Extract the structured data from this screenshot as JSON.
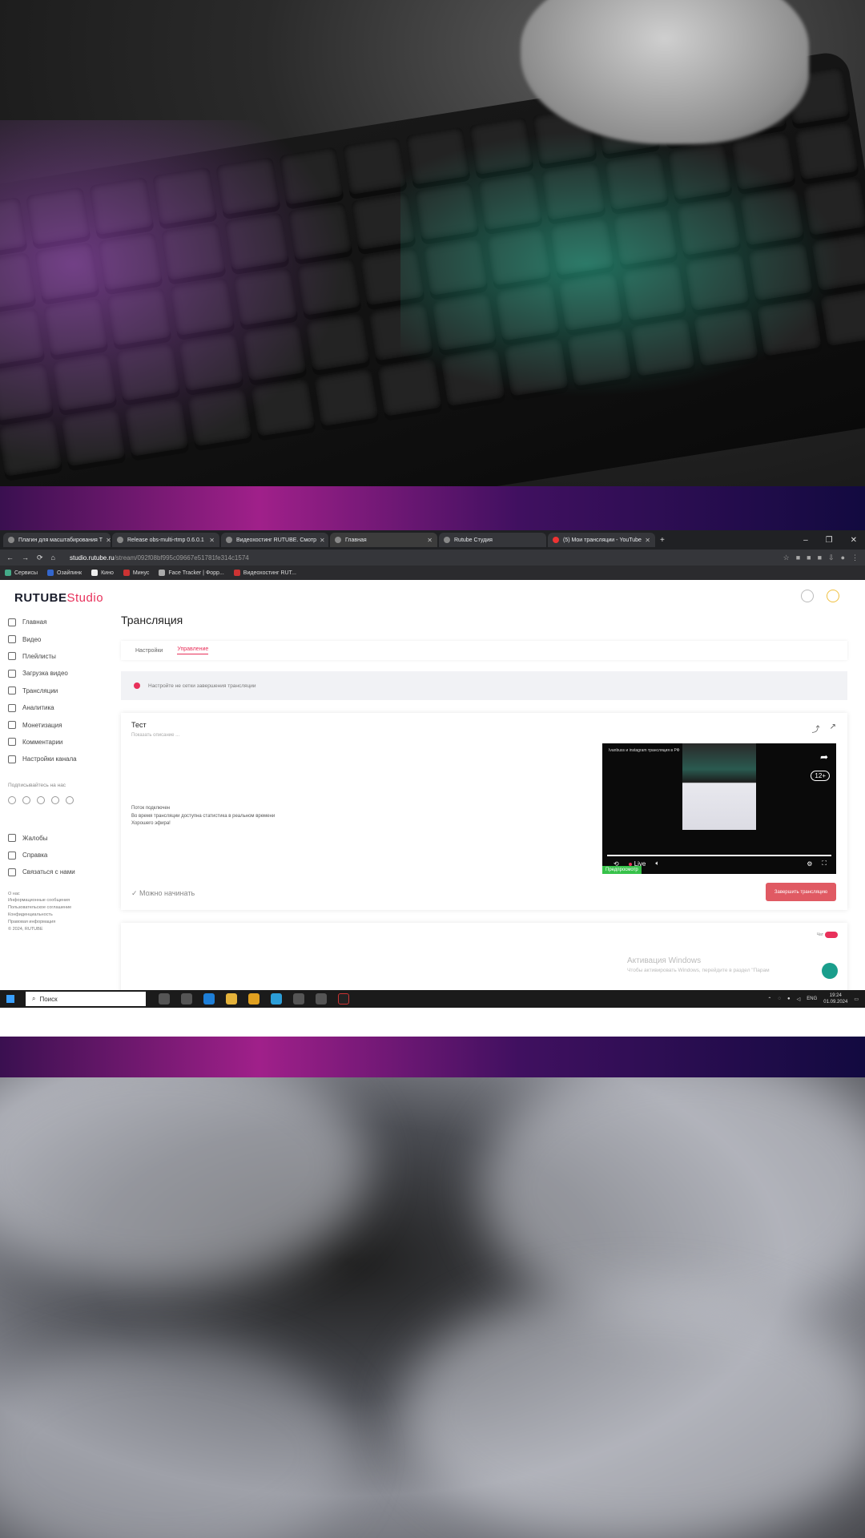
{
  "browser": {
    "tabs": [
      {
        "title": "Плагин для масштабирования Т"
      },
      {
        "title": "Release obs-multi-rtmp 0.6.0.1"
      },
      {
        "title": "Видеохостинг RUTUBE. Смотр"
      },
      {
        "title": "Главная"
      },
      {
        "title": "Rutube Студия"
      },
      {
        "title": "(5) Мои трансляции - YouTube"
      }
    ],
    "url_host": "studio.rutube.ru",
    "url_path": "/stream/092f08bf995c09667e51781fe314c1574",
    "bookmarks": [
      "Сервисы",
      "Озайпинк",
      "Кино",
      "Минус",
      "Face Tracker | Форр...",
      "Видеохостинг RUT..."
    ]
  },
  "rutube": {
    "logo_main": "RUTUBE",
    "logo_studio": "Studio",
    "nav": [
      {
        "label": "Главная",
        "icon": "home-icon"
      },
      {
        "label": "Видео",
        "icon": "video-icon"
      },
      {
        "label": "Плейлисты",
        "icon": "playlist-icon"
      },
      {
        "label": "Загрузка видео",
        "icon": "upload-icon"
      },
      {
        "label": "Трансляции",
        "icon": "broadcast-icon"
      },
      {
        "label": "Аналитика",
        "icon": "analytics-icon"
      },
      {
        "label": "Монетизация",
        "icon": "coin-icon"
      },
      {
        "label": "Комментарии",
        "icon": "comment-icon"
      },
      {
        "label": "Настройки канала",
        "icon": "settings-icon"
      }
    ],
    "subscribe_text": "Подписывайтесь на нас",
    "extra_nav": [
      {
        "label": "Жалобы",
        "icon": "flag-icon"
      },
      {
        "label": "Справка",
        "icon": "help-icon"
      },
      {
        "label": "Связаться с нами",
        "icon": "mail-icon"
      }
    ],
    "footer_links": [
      "О нас",
      "Информационные сообщения",
      "Пользовательское соглашение",
      "Конфиденциальность",
      "Правовая информация",
      "© 2024, RUTUBE"
    ],
    "page_title": "Трансляция",
    "tabs": {
      "settings": "Настройки",
      "control": "Управление"
    },
    "warning_text": "Настройте не сетки завершения трансляции",
    "stream": {
      "title": "Тест",
      "description_placeholder": "Показать описание ...",
      "notes": [
        "Поток подключен",
        "Во время трансляции доступна статистика в реальном времени",
        "Хорошего эфира!"
      ],
      "ready_status": "Можно начинать",
      "stop_button": "Завершить трансляцию"
    },
    "player": {
      "overlay_title": "Ivanbuss и instagram трансляция в РФ",
      "age_badge": "12+",
      "live_label": "Live",
      "preview_label": "Предпросмотр",
      "progress": 1.0
    },
    "chat_label": "Чат"
  },
  "windows": {
    "activation_title": "Активация Windows",
    "activation_sub": "Чтобы активировать Windows, перейдите в раздел \"Парам",
    "search_placeholder": "Поиск",
    "lang": "ENG",
    "time": "19:24",
    "date": "01.09.2024"
  },
  "colors": {
    "accent": "#e8305a",
    "stop_button": "#e05a63",
    "preview_green": "#37c24a"
  }
}
